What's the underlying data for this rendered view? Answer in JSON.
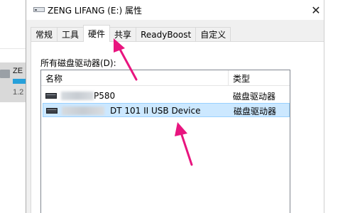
{
  "background": {
    "drive_label": "ZE",
    "drive_size": "1.2"
  },
  "dialog": {
    "title": "ZENG LIFANG (E:) 属性",
    "close_glyph": "✕",
    "tabs": [
      {
        "label": "常规",
        "active": false
      },
      {
        "label": "工具",
        "active": false
      },
      {
        "label": "硬件",
        "active": true
      },
      {
        "label": "共享",
        "active": false
      },
      {
        "label": "ReadyBoost",
        "active": false
      },
      {
        "label": "自定义",
        "active": false
      }
    ],
    "hardware": {
      "section_label": "所有磁盘驱动器(D):",
      "columns": {
        "name": "名称",
        "type": "类型"
      },
      "rows": [
        {
          "name_visible": "P580",
          "type": "磁盘驱动器",
          "selected": false
        },
        {
          "name_visible": "DT 101 II USB Device",
          "type": "磁盘驱动器",
          "selected": true
        }
      ]
    }
  },
  "annotations": {
    "arrow_color": "#e8157f"
  },
  "icons": [
    "drive-icon",
    "disk-drive-icon",
    "close-icon"
  ]
}
